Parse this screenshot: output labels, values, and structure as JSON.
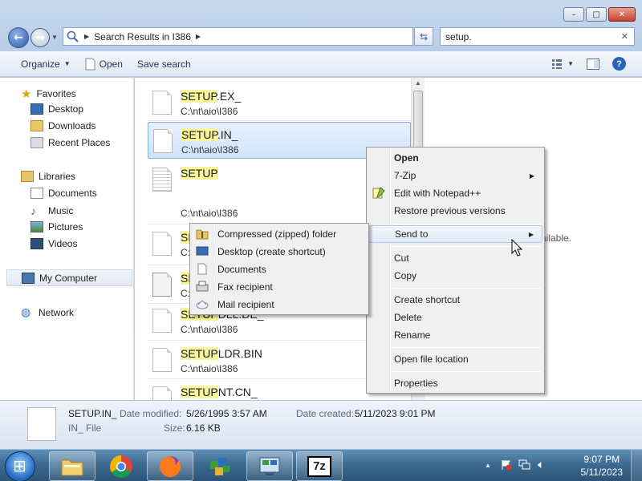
{
  "window": {
    "address": {
      "root_icon": "magnifier-folder-icon",
      "crumb": "Search Results in I386"
    },
    "search": {
      "value": "setup."
    },
    "caption": {
      "minimize": "–",
      "maximize": "□",
      "close": "✕"
    }
  },
  "toolbar": {
    "organize": "Organize",
    "open": "Open",
    "save_search": "Save search"
  },
  "nav": {
    "favorites": "Favorites",
    "desktop": "Desktop",
    "downloads": "Downloads",
    "recent": "Recent Places",
    "libraries": "Libraries",
    "documents": "Documents",
    "music": "Music",
    "pictures": "Pictures",
    "videos": "Videos",
    "computer": "My Computer",
    "network": "Network"
  },
  "files": [
    {
      "hl": "SETUP",
      "rest": ".EX_",
      "path": "C:\\nt\\aio\\I386"
    },
    {
      "hl": "SETUP",
      "rest": ".IN_",
      "path": "C:\\nt\\aio\\I386"
    },
    {
      "hl": "SETUP",
      "rest": "",
      "path": "C:\\nt\\aio\\I386"
    },
    {
      "hl": "SE",
      "rest": "",
      "path": "C:"
    },
    {
      "hl": "SE",
      "rest": "",
      "path": "C:"
    },
    {
      "hl": "SETUP",
      "rest": "DLL.DE_",
      "path": "C:\\nt\\aio\\I386"
    },
    {
      "hl": "SETUP",
      "rest": "LDR.BIN",
      "path": "C:\\nt\\aio\\I386"
    },
    {
      "hl": "SETUP",
      "rest": "NT.CN_",
      "path": ""
    }
  ],
  "details_pane": {
    "partial_text": "ailable."
  },
  "context_menu": {
    "open": "Open",
    "zip7": "7-Zip",
    "notepad": "Edit with Notepad++",
    "restore": "Restore previous versions",
    "send_to": "Send to",
    "cut": "Cut",
    "copy": "Copy",
    "create_shortcut": "Create shortcut",
    "delete": "Delete",
    "rename": "Rename",
    "open_location": "Open file location",
    "properties": "Properties"
  },
  "send_to_menu": {
    "zip": "Compressed (zipped) folder",
    "desktop": "Desktop (create shortcut)",
    "documents": "Documents",
    "fax": "Fax recipient",
    "mail": "Mail recipient"
  },
  "status": {
    "name": "SETUP.IN_",
    "type": "IN_ File",
    "modified_label": "Date modified:",
    "modified": "5/26/1995 3:57 AM",
    "created_label": "Date created:",
    "created": "5/11/2023 9:01 PM",
    "size_label": "Size:",
    "size": "6.16 KB"
  },
  "taskbar": {
    "time": "9:07 PM",
    "date": "5/11/2023",
    "zip_label": "7z"
  },
  "colors": {
    "highlight": "#f9f59a",
    "selection": "#cfe3fb",
    "taskbar": "#3e6b92"
  }
}
